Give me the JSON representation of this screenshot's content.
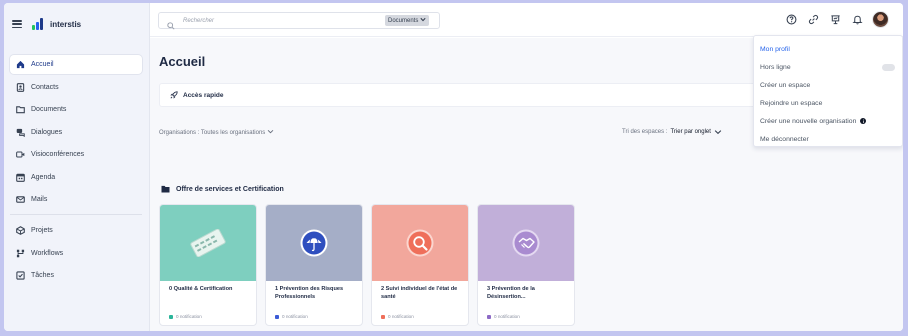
{
  "app": {
    "name": "interstis"
  },
  "sidebar": {
    "items": [
      {
        "label": "Accueil",
        "icon": "home-icon",
        "active": true
      },
      {
        "label": "Contacts",
        "icon": "contacts-icon"
      },
      {
        "label": "Documents",
        "icon": "folder-icon"
      },
      {
        "label": "Dialogues",
        "icon": "chat-icon"
      },
      {
        "label": "Visioconférences",
        "icon": "video-icon"
      },
      {
        "label": "Agenda",
        "icon": "calendar-icon"
      },
      {
        "label": "Mails",
        "icon": "mail-icon"
      }
    ],
    "secondary_items": [
      {
        "label": "Projets",
        "icon": "projects-icon"
      },
      {
        "label": "Workflows",
        "icon": "workflow-icon"
      },
      {
        "label": "Tâches",
        "icon": "checkbox-icon"
      }
    ]
  },
  "topbar": {
    "search_placeholder": "Rechercher",
    "scope": "Documents"
  },
  "main": {
    "title": "Accueil",
    "quick_access": "Accès rapide",
    "org_filter": "Organisations : Toutes les organisations",
    "sort_prefix": "Tri des espaces :",
    "sort_value": "Trier par onglet",
    "section_title": "Offre de services et Certification",
    "cards": [
      {
        "title": "0 Qualité & Certification",
        "notif": "0 notification",
        "color": "#7ecfbf",
        "dot": "#2bb59a"
      },
      {
        "title": "1 Prévention des Risques Professionnels",
        "notif": "0 notification",
        "color": "#a5aec7",
        "dot": "#3b5bd6"
      },
      {
        "title": "2 Suivi individuel de l'état de santé",
        "notif": "0 notification",
        "color": "#f2a79c",
        "dot": "#ef6f5a"
      },
      {
        "title": "3 Prévention de la Désinsertion...",
        "notif": "0 notification",
        "color": "#c1afd9",
        "dot": "#8d6ac6"
      }
    ]
  },
  "dropdown": {
    "items": [
      "Mon profil",
      "Hors ligne",
      "Créer un espace",
      "Rejoindre un espace",
      "Créer une nouvelle organisation",
      "Me déconnecter"
    ]
  },
  "colors": {
    "brand": "#1e3a8a",
    "accent": "#2563eb",
    "sidebar_bg": "#f1f3fa"
  }
}
